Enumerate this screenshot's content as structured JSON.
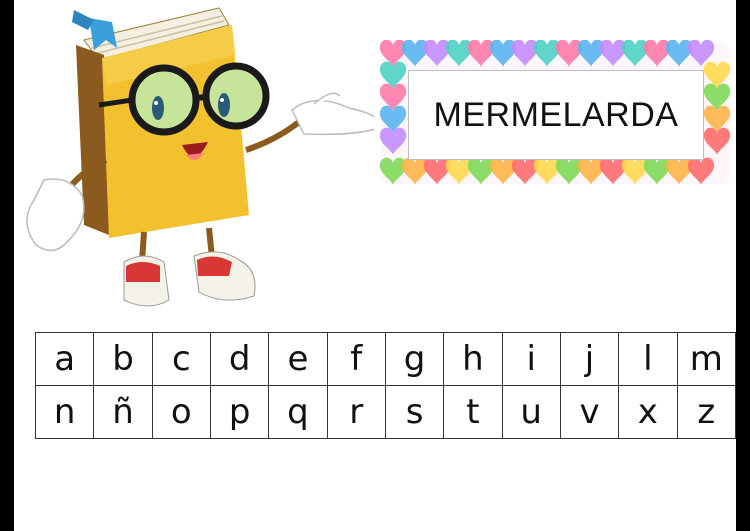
{
  "word": "MERMELARDA",
  "alphabet": {
    "row1": [
      "a",
      "b",
      "c",
      "d",
      "e",
      "f",
      "g",
      "h",
      "i",
      "j",
      "l",
      "m"
    ],
    "row2": [
      "n",
      "ñ",
      "o",
      "p",
      "q",
      "r",
      "s",
      "t",
      "u",
      "v",
      "x",
      "z"
    ]
  },
  "colors": {
    "background_edge": "#000000",
    "page": "#ffffff",
    "book_cover": "#f3c12e",
    "book_spine": "#8a5a1e",
    "glasses_lens": "#c7e59a",
    "bookmark": "#3aa0dc",
    "frame_hearts": [
      "#ff7aa8",
      "#7ed957",
      "#5ab4f0",
      "#ffb347",
      "#c48bff",
      "#ff6b6b",
      "#4fd1c5",
      "#ffd84d"
    ]
  },
  "icons": [
    "book-mascot-illustration",
    "heart-frame-border"
  ]
}
